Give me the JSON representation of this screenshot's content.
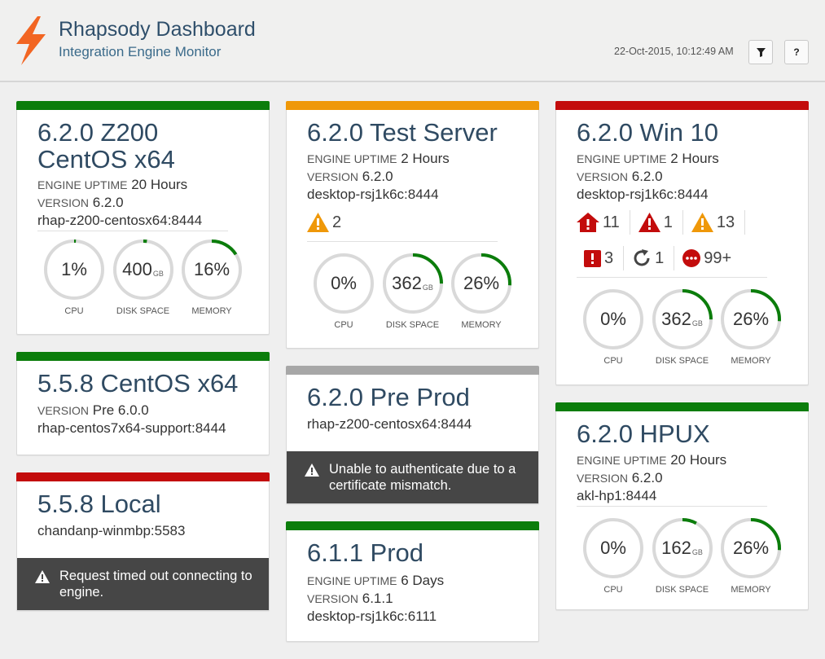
{
  "app": {
    "title": "Rhapsody Dashboard",
    "subtitle": "Integration Engine Monitor",
    "datetime": "22-Oct-2015, 10:12:49 AM",
    "help_label": "?",
    "brand_color": "#f26522"
  },
  "labels": {
    "uptime": "ENGINE UPTIME",
    "version": "VERSION",
    "cpu": "CPU",
    "disk": "DISK SPACE",
    "memory": "MEMORY",
    "gb": "GB"
  },
  "status_colors": {
    "ok": "#0b7d0b",
    "warning": "#ef9809",
    "error": "#c30c0c",
    "unknown": "#a7a7a7"
  },
  "cards": {
    "z200": {
      "title_line1": "6.2.0 Z200",
      "title_line2": "CentOS x64",
      "uptime": "20 Hours",
      "version": "6.2.0",
      "host": "rhap-z200-centosx64:8444",
      "cpu": "1%",
      "cpu_fraction": 0.01,
      "disk": "400",
      "disk_fraction": 0.02,
      "memory": "16%",
      "memory_fraction": 0.16
    },
    "centos": {
      "title": "5.5.8 CentOS x64",
      "version": "Pre 6.0.0",
      "host": "rhap-centos7x64-support:8444"
    },
    "local": {
      "title": "5.5.8 Local",
      "host": "chandanp-winmbp:5583",
      "error": "Request timed out connecting to engine."
    },
    "test": {
      "title": "6.2.0 Test Server",
      "uptime": "2 Hours",
      "version": "6.2.0",
      "host": "desktop-rsj1k6c:8444",
      "warnings": "2",
      "cpu": "0%",
      "cpu_fraction": 0.0,
      "disk": "362",
      "disk_fraction": 0.25,
      "memory": "26%",
      "memory_fraction": 0.26
    },
    "preprod": {
      "title": "6.2.0 Pre Prod",
      "host": "rhap-z200-centosx64:8444",
      "error": "Unable to authenticate due to a certificate mismatch."
    },
    "prod": {
      "title": "6.1.1 Prod",
      "uptime": "6 Days",
      "version": "6.1.1",
      "host": "desktop-rsj1k6c:6111"
    },
    "win10": {
      "title": "6.2.0 Win 10",
      "uptime": "2 Hours",
      "version": "6.2.0",
      "host": "desktop-rsj1k6c:8444",
      "alert_counts": {
        "home_error": "11",
        "error": "1",
        "warning": "13",
        "stopped": "3",
        "retry": "1",
        "blocked": "99+"
      },
      "cpu": "0%",
      "cpu_fraction": 0.0,
      "disk": "362",
      "disk_fraction": 0.25,
      "memory": "26%",
      "memory_fraction": 0.26
    },
    "hpux": {
      "title": "6.2.0 HPUX",
      "uptime": "20 Hours",
      "version": "6.2.0",
      "host": "akl-hp1:8444",
      "cpu": "0%",
      "cpu_fraction": 0.0,
      "disk": "162",
      "disk_fraction": 0.08,
      "memory": "26%",
      "memory_fraction": 0.26
    }
  }
}
